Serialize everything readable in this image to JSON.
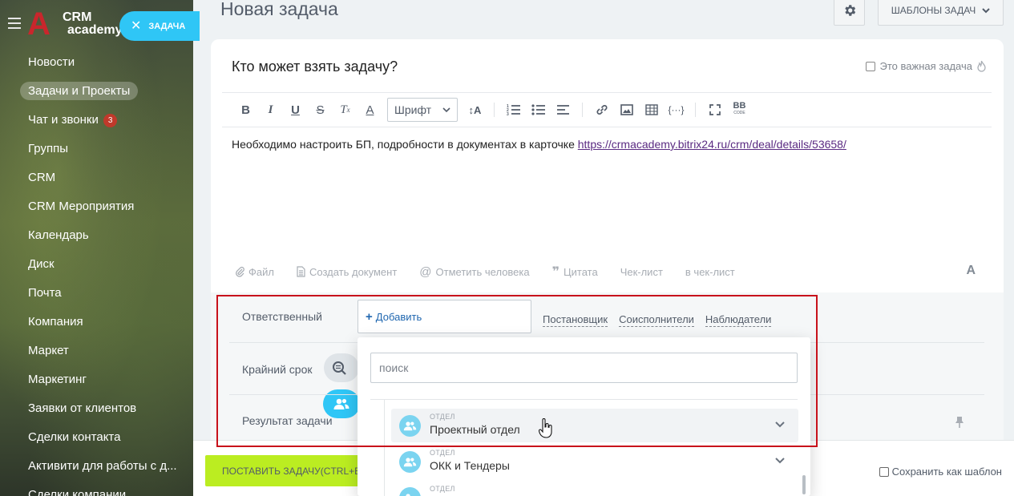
{
  "sidebar": {
    "logo_text_1": "CRM",
    "logo_text_2": "academy",
    "task_pill_label": "ЗАДАЧА",
    "items": [
      {
        "label": "Новости"
      },
      {
        "label": "Задачи и Проекты",
        "active": true
      },
      {
        "label": "Чат и звонки",
        "badge": "3"
      },
      {
        "label": "Группы"
      },
      {
        "label": "CRM"
      },
      {
        "label": "CRM Мероприятия"
      },
      {
        "label": "Календарь"
      },
      {
        "label": "Диск"
      },
      {
        "label": "Почта"
      },
      {
        "label": "Компания"
      },
      {
        "label": "Маркет"
      },
      {
        "label": "Маркетинг"
      },
      {
        "label": "Заявки от клиентов"
      },
      {
        "label": "Сделки контакта"
      },
      {
        "label": "Активити для работы с д..."
      },
      {
        "label": "Сделки компании"
      }
    ]
  },
  "header": {
    "title": "Новая задача",
    "templates_button": "ШАБЛОНЫ ЗАДАЧ"
  },
  "task": {
    "title": "Кто может взять задачу?",
    "important_label": "Это важная задача",
    "description_text": "Необходимо настроить БП, подробности в документах в карточке ",
    "description_link": "https://crmacademy.bitrix24.ru/crm/deal/details/53658/"
  },
  "toolbar": {
    "font_label": "Шрифт"
  },
  "bottom_tools": {
    "file": "Файл",
    "create_doc": "Создать документ",
    "mention": "Отметить человека",
    "quote": "Цитата",
    "checklist": "Чек-лист",
    "to_checklist": "в чек-лист",
    "font_toggle": "A"
  },
  "fields": {
    "responsible_label": "Ответственный",
    "add_label": "Добавить",
    "roles": [
      "Постановщик",
      "Соисполнители",
      "Наблюдатели"
    ],
    "deadline_label": "Крайний срок",
    "result_label": "Результат задачи"
  },
  "popup": {
    "search_placeholder": "поиск",
    "departments": [
      {
        "caption": "ОТДЕЛ",
        "name": "Проектный отдел"
      },
      {
        "caption": "ОТДЕЛ",
        "name": "ОКК и Тендеры"
      },
      {
        "caption": "ОТДЕЛ",
        "name": ""
      }
    ]
  },
  "footer": {
    "submit_label": "ПОСТАВИТЬ ЗАДАЧУ(CTRL+ENTER)",
    "save_template_label": "Сохранить как шаблон"
  },
  "colors": {
    "accent_blue": "#2fc6f6",
    "submit_green": "#bbed21",
    "highlight_red": "#c8121b",
    "link_purple": "#5a2a82"
  }
}
